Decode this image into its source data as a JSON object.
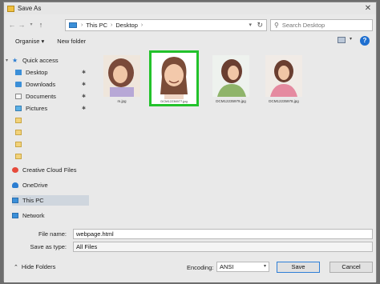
{
  "window": {
    "title": "Save As"
  },
  "address": {
    "crumbs": [
      "This PC",
      "Desktop"
    ]
  },
  "search": {
    "placeholder": "Search Desktop"
  },
  "toolbar": {
    "organise": "Organise ▾",
    "new_folder": "New folder"
  },
  "sidebar": {
    "quick_access": "Quick access",
    "desktop": "Desktop",
    "downloads": "Downloads",
    "documents": "Documents",
    "pictures": "Pictures",
    "creative_cloud": "Creative Cloud Files",
    "onedrive": "OneDrive",
    "this_pc": "This PC",
    "network": "Network"
  },
  "files": [
    {
      "name": "m.jpg"
    },
    {
      "name": "DCM12236977.jpg"
    },
    {
      "name": "DCM12235979.jpg"
    },
    {
      "name": "DCM12235978.jpg"
    }
  ],
  "form": {
    "file_name_label": "File name:",
    "file_name_value": "webpage.html",
    "save_type_label": "Save as type:",
    "save_type_value": "All Files",
    "hide_folders": "Hide Folders",
    "encoding_label": "Encoding:",
    "encoding_value": "ANSI",
    "save": "Save",
    "cancel": "Cancel"
  },
  "colors": {
    "selection_highlight": "#22c22b",
    "overlay": "#6d6d6d"
  }
}
